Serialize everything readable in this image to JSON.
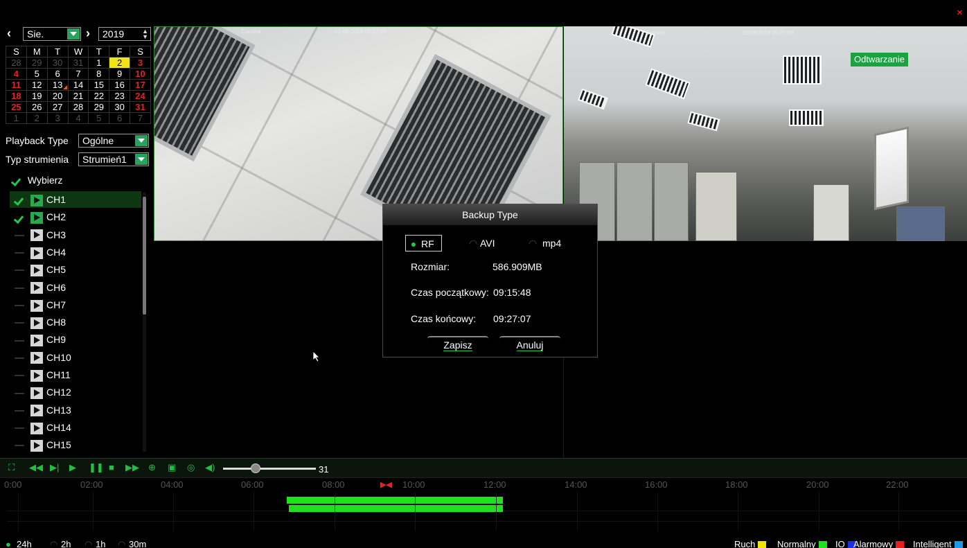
{
  "calendar": {
    "month": "Sie.",
    "year": "2019",
    "weekdays": [
      "S",
      "M",
      "T",
      "W",
      "T",
      "F",
      "S"
    ],
    "weeks": [
      [
        "28",
        "29",
        "30",
        "31",
        "1",
        "2",
        "3"
      ],
      [
        "4",
        "5",
        "6",
        "7",
        "8",
        "9",
        "10"
      ],
      [
        "11",
        "12",
        "13",
        "14",
        "15",
        "16",
        "17"
      ],
      [
        "18",
        "19",
        "20",
        "21",
        "22",
        "23",
        "24"
      ],
      [
        "25",
        "26",
        "27",
        "28",
        "29",
        "30",
        "31"
      ],
      [
        "1",
        "2",
        "3",
        "4",
        "5",
        "6",
        "7"
      ]
    ],
    "selected_day": "2"
  },
  "playback_type": {
    "label": "Playback Type",
    "value": "Ogólne"
  },
  "stream_type": {
    "label": "Typ strumienia",
    "value": "Strumień1"
  },
  "select_all": "Wybierz",
  "channels": [
    {
      "name": "CH1",
      "checked": true
    },
    {
      "name": "CH2",
      "checked": true
    },
    {
      "name": "CH3",
      "checked": false
    },
    {
      "name": "CH4",
      "checked": false
    },
    {
      "name": "CH5",
      "checked": false
    },
    {
      "name": "CH6",
      "checked": false
    },
    {
      "name": "CH7",
      "checked": false
    },
    {
      "name": "CH8",
      "checked": false
    },
    {
      "name": "CH9",
      "checked": false
    },
    {
      "name": "CH10",
      "checked": false
    },
    {
      "name": "CH11",
      "checked": false
    },
    {
      "name": "CH12",
      "checked": false
    },
    {
      "name": "CH13",
      "checked": false
    },
    {
      "name": "CH14",
      "checked": false
    },
    {
      "name": "CH15",
      "checked": false
    }
  ],
  "video": {
    "cam1_osd_name": "Camera",
    "cam1_osd_time": "02-08-2019 09:27:09",
    "cam2_osd_name": "Camera",
    "cam2_osd_time": "02/08/2019 09:27:09",
    "status_badge": "Odtwarzanie"
  },
  "dialog": {
    "title": "Backup Type",
    "options": [
      "RF",
      "AVI",
      "mp4"
    ],
    "selected_option": "RF",
    "size_label": "Rozmiar:",
    "size_value": "586.909MB",
    "start_label": "Czas początkowy:",
    "start_value": "09:15:48",
    "end_label": "Czas końcowy:",
    "end_value": "09:27:07",
    "save_label": "Zapisz",
    "cancel_label": "Anuluj"
  },
  "controls": {
    "volume_value": "31"
  },
  "timeline": {
    "ticks": [
      "0:00",
      "02:00",
      "04:00",
      "06:00",
      "08:00",
      "10:00",
      "12:00",
      "14:00",
      "16:00",
      "18:00",
      "20:00",
      "22:00"
    ]
  },
  "zoom_options": [
    "24h",
    "2h",
    "1h",
    "30m"
  ],
  "selected_zoom": "24h",
  "legend": [
    {
      "label": "Ruch",
      "color": "#f2e600"
    },
    {
      "label": "Normalny",
      "color": "#1de11d"
    },
    {
      "label": "IO",
      "color": "#1d2ee8"
    },
    {
      "label": "Alarmowy",
      "color": "#e81d1d"
    },
    {
      "label": "Intelligent",
      "color": "#1d9be8"
    }
  ]
}
